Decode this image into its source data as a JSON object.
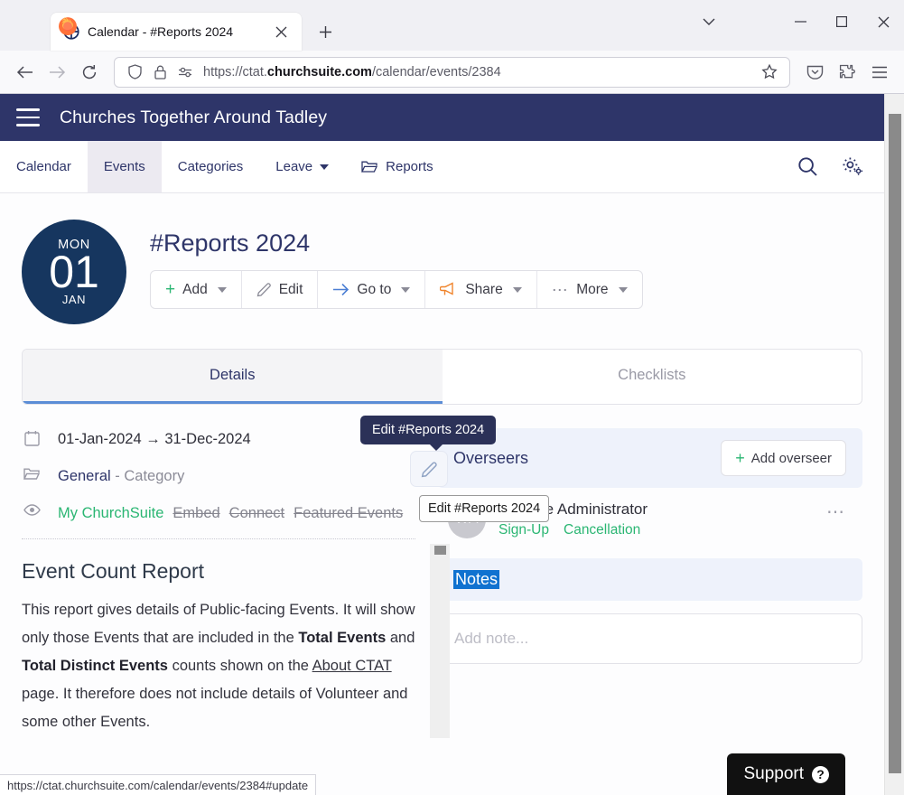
{
  "browser": {
    "tab": {
      "title": "Calendar - #Reports 2024",
      "favicon_icon": "churchsuite-cross-icon",
      "close_icon": "close-icon"
    },
    "new_tab_icon": "plus-icon",
    "list_all_tabs_icon": "chevron-down-icon",
    "window_controls": {
      "minimize_icon": "minimize-icon",
      "maximize_icon": "maximize-icon",
      "close_icon": "close-icon"
    },
    "toolbar": {
      "back_icon": "arrow-left-icon",
      "forward_icon": "arrow-right-icon",
      "reload_icon": "reload-icon",
      "shield_icon": "shield-icon",
      "lock_icon": "lock-icon",
      "permissions_icon": "permissions-icon",
      "bookmark_star_icon": "star-icon",
      "pocket_icon": "pocket-icon",
      "extensions_icon": "puzzle-piece-icon",
      "app_menu_icon": "hamburger-menu-icon"
    },
    "url": {
      "scheme": "https://ctat.",
      "domain": "churchsuite.com",
      "path": "/calendar/events/2384"
    },
    "status_bar_url": "https://ctat.churchsuite.com/calendar/events/2384#update"
  },
  "site": {
    "header": {
      "menu_icon": "hamburger-menu-icon",
      "title": "Churches Together Around Tadley"
    },
    "nav": {
      "items": [
        {
          "label": "Calendar",
          "active": false,
          "has_caret": false,
          "icon": ""
        },
        {
          "label": "Events",
          "active": true,
          "has_caret": false,
          "icon": ""
        },
        {
          "label": "Categories",
          "active": false,
          "has_caret": false,
          "icon": ""
        },
        {
          "label": "Leave",
          "active": false,
          "has_caret": true,
          "icon": ""
        },
        {
          "label": "Reports",
          "active": false,
          "has_caret": false,
          "icon": "folder-icon"
        }
      ],
      "search_icon": "search-icon",
      "settings_icon": "gears-icon"
    }
  },
  "event": {
    "date_badge": {
      "dow": "MON",
      "day": "01",
      "month": "JAN"
    },
    "title": "#Reports 2024",
    "actions": [
      {
        "label": "Add",
        "icon": "plus-icon",
        "caret": true
      },
      {
        "label": "Edit",
        "icon": "pencil-icon",
        "caret": false
      },
      {
        "label": "Go to",
        "icon": "arrow-right-icon",
        "caret": true
      },
      {
        "label": "Share",
        "icon": "megaphone-icon",
        "caret": true
      },
      {
        "label": "More",
        "icon": "ellipsis-icon",
        "caret": true
      }
    ],
    "tabs": [
      {
        "label": "Details",
        "active": true
      },
      {
        "label": "Checklists",
        "active": false
      }
    ],
    "details": {
      "date_range": "01-Jan-2024 → 31-Dec-2024",
      "date_icon": "calendar-icon",
      "category_name": "General",
      "category_suffix": "- Category",
      "category_icon": "folder-icon",
      "visibility_icon": "eye-icon",
      "visibility": {
        "active": "My ChurchSuite",
        "inactive": [
          "Embed",
          "Connect",
          "Featured Events"
        ]
      }
    },
    "report": {
      "title": "Event Count Report",
      "paragraph_parts": {
        "p1": "This report gives details of Public-facing Events.  It will show only those Events that are included in the ",
        "b1": "Total Events",
        "p2": " and ",
        "b2": "Total Distinct Events",
        "p3": " counts shown on the ",
        "u1": "About CTAT",
        "p4": " page.  It therefore does not include details of Volunteer and some other Events."
      }
    },
    "edit_fab": {
      "icon": "pencil-icon"
    },
    "tooltip_dark": "Edit #Reports 2024",
    "tooltip_light": "Edit #Reports 2024"
  },
  "overseers": {
    "title": "Overseers",
    "add_button": {
      "label": "Add overseer",
      "icon": "plus-icon"
    },
    "people": [
      {
        "initials": "WA",
        "name": "Website Administrator",
        "links": [
          "Sign-Up",
          "Cancellation"
        ],
        "menu_icon": "ellipsis-icon"
      }
    ]
  },
  "notes": {
    "title": "Notes",
    "title_selected": true,
    "placeholder": "Add note..."
  },
  "support": {
    "label": "Support",
    "icon": "question-mark-icon"
  },
  "colors": {
    "brand_navy": "#2e3569",
    "date_badge": "#16365f",
    "green": "#2bb673",
    "orange": "#f0842c",
    "selection_blue": "#1072d0",
    "tab_underline": "#5b8dd6"
  }
}
